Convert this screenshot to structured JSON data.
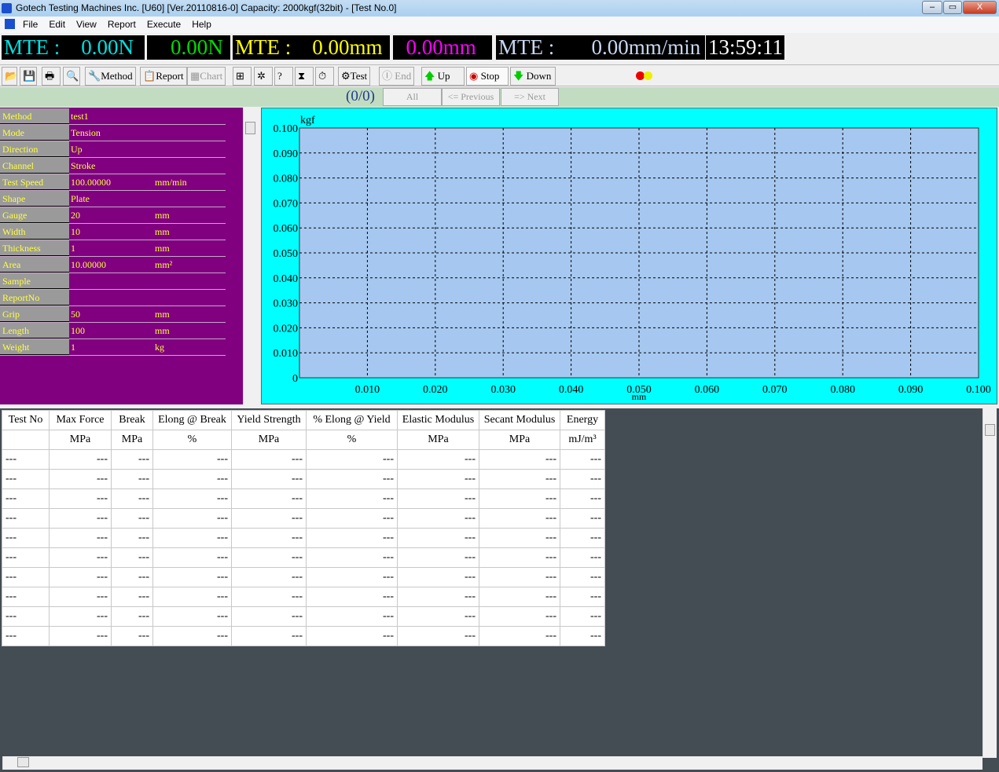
{
  "window": {
    "title": "Gotech Testing Machines Inc. [U60] [Ver.20110816-0] Capacity:  2000kgf(32bit) - [Test No.0]",
    "minimize": "–",
    "restore": "▭",
    "close": "X"
  },
  "menu": [
    "File",
    "Edit",
    "View",
    "Report",
    "Execute",
    "Help"
  ],
  "displays": [
    {
      "text": "MTE :    0.00N",
      "color": "#00e0e0"
    },
    {
      "text": "    0.00N",
      "color": "#00dd00"
    },
    {
      "text": "MTE :    0.00mm",
      "color": "#ffff00"
    },
    {
      "text": "  0.00mm",
      "color": "#ff00ff"
    },
    {
      "text": "MTE :       0.00mm/min",
      "color": "#c8d8f0"
    },
    {
      "text": "13:59:11",
      "color": "#ffffff"
    }
  ],
  "toolbar": {
    "method": "Method",
    "report": "Report",
    "chart": "Chart",
    "test": "Test",
    "end": "End",
    "up": "Up",
    "stop": "Stop",
    "down": "Down"
  },
  "nav": {
    "counter": "(0/0)",
    "all": "All",
    "previous": "<= Previous",
    "next": "=> Next"
  },
  "params": [
    {
      "k": "Method",
      "v": "test1",
      "u": ""
    },
    {
      "k": "Mode",
      "v": "Tension",
      "u": ""
    },
    {
      "k": "Direction",
      "v": "Up",
      "u": ""
    },
    {
      "k": "Channel",
      "v": "Stroke",
      "u": ""
    },
    {
      "k": "Test Speed",
      "v": "100.00000",
      "u": "mm/min"
    },
    {
      "k": "Shape",
      "v": "Plate",
      "u": ""
    },
    {
      "k": "Gauge",
      "v": "20",
      "u": "mm"
    },
    {
      "k": "Width",
      "v": "10",
      "u": "mm"
    },
    {
      "k": "Thickness",
      "v": "1",
      "u": "mm"
    },
    {
      "k": "Area",
      "v": "10.00000",
      "u": "mm²"
    },
    {
      "k": "Sample",
      "v": "",
      "u": ""
    },
    {
      "k": "ReportNo",
      "v": "",
      "u": ""
    },
    {
      "k": "Grip",
      "v": "50",
      "u": "mm"
    },
    {
      "k": "Length",
      "v": "100",
      "u": "mm"
    },
    {
      "k": "Weight",
      "v": "1",
      "u": "kg"
    }
  ],
  "chart_data": {
    "type": "line",
    "xlabel": "mm",
    "ylabel": "kgf",
    "xlim": [
      0,
      0.1
    ],
    "ylim": [
      0,
      0.1
    ],
    "xticks": [
      "0.010",
      "0.020",
      "0.030",
      "0.040",
      "0.050",
      "0.060",
      "0.070",
      "0.080",
      "0.090",
      "0.100"
    ],
    "yticks": [
      "0",
      "0.010",
      "0.020",
      "0.030",
      "0.040",
      "0.050",
      "0.060",
      "0.070",
      "0.080",
      "0.090",
      "0.100"
    ],
    "grid": true,
    "series": [],
    "colors": {
      "background": "#00ffff",
      "plot": "#a6c8f0"
    }
  },
  "table": {
    "headers": [
      [
        "Test No",
        ""
      ],
      [
        "Max Force",
        "MPa"
      ],
      [
        "Break",
        "MPa"
      ],
      [
        "Elong @ Break",
        "%"
      ],
      [
        "Yield Strength",
        "MPa"
      ],
      [
        "% Elong @ Yield",
        "%"
      ],
      [
        "Elastic Modulus",
        "MPa"
      ],
      [
        "Secant Modulus",
        "MPa"
      ],
      [
        "Energy",
        "mJ/m³"
      ]
    ],
    "rows": [
      [
        "---",
        "---",
        "---",
        "---",
        "---",
        "---",
        "---",
        "---",
        "---"
      ],
      [
        "---",
        "---",
        "---",
        "---",
        "---",
        "---",
        "---",
        "---",
        "---"
      ],
      [
        "---",
        "---",
        "---",
        "---",
        "---",
        "---",
        "---",
        "---",
        "---"
      ],
      [
        "---",
        "---",
        "---",
        "---",
        "---",
        "---",
        "---",
        "---",
        "---"
      ],
      [
        "---",
        "---",
        "---",
        "---",
        "---",
        "---",
        "---",
        "---",
        "---"
      ],
      [
        "---",
        "---",
        "---",
        "---",
        "---",
        "---",
        "---",
        "---",
        "---"
      ],
      [
        "---",
        "---",
        "---",
        "---",
        "---",
        "---",
        "---",
        "---",
        "---"
      ],
      [
        "---",
        "---",
        "---",
        "---",
        "---",
        "---",
        "---",
        "---",
        "---"
      ],
      [
        "---",
        "---",
        "---",
        "---",
        "---",
        "---",
        "---",
        "---",
        "---"
      ],
      [
        "---",
        "---",
        "---",
        "---",
        "---",
        "---",
        "---",
        "---",
        "---"
      ]
    ]
  }
}
